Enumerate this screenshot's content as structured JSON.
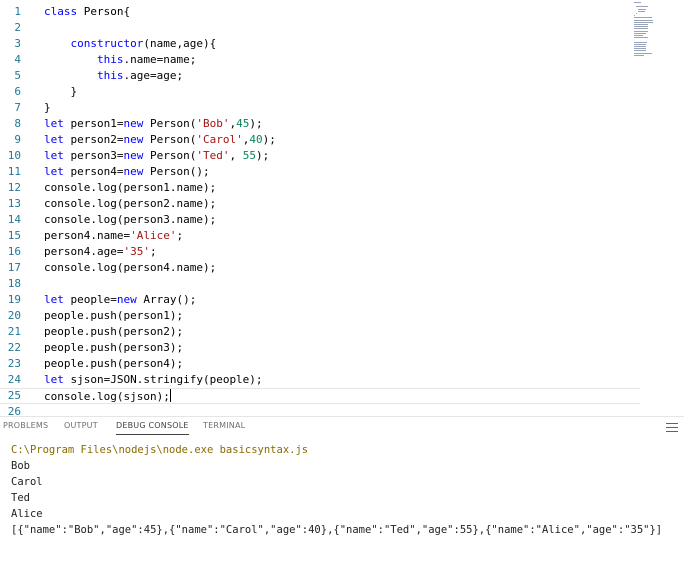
{
  "editor": {
    "lines": [
      {
        "n": "1",
        "tokens": [
          {
            "t": "class",
            "c": "kw"
          },
          {
            "t": " Person{",
            "c": ""
          }
        ]
      },
      {
        "n": "2",
        "tokens": []
      },
      {
        "n": "3",
        "tokens": [
          {
            "t": "    constructor",
            "c": "kw"
          },
          {
            "t": "(name,age){",
            "c": ""
          }
        ]
      },
      {
        "n": "4",
        "tokens": [
          {
            "t": "        this",
            "c": "kw"
          },
          {
            "t": ".name=name;",
            "c": ""
          }
        ]
      },
      {
        "n": "5",
        "tokens": [
          {
            "t": "        this",
            "c": "kw"
          },
          {
            "t": ".age=age;",
            "c": ""
          }
        ]
      },
      {
        "n": "6",
        "tokens": [
          {
            "t": "    }",
            "c": ""
          }
        ]
      },
      {
        "n": "7",
        "tokens": [
          {
            "t": "}",
            "c": ""
          }
        ]
      },
      {
        "n": "8",
        "tokens": [
          {
            "t": "let",
            "c": "kw"
          },
          {
            "t": " person1=",
            "c": ""
          },
          {
            "t": "new",
            "c": "kw"
          },
          {
            "t": " Person(",
            "c": ""
          },
          {
            "t": "'Bob'",
            "c": "str"
          },
          {
            "t": ",",
            "c": ""
          },
          {
            "t": "45",
            "c": "num"
          },
          {
            "t": ");",
            "c": ""
          }
        ]
      },
      {
        "n": "9",
        "tokens": [
          {
            "t": "let",
            "c": "kw"
          },
          {
            "t": " person2=",
            "c": ""
          },
          {
            "t": "new",
            "c": "kw"
          },
          {
            "t": " Person(",
            "c": ""
          },
          {
            "t": "'Carol'",
            "c": "str"
          },
          {
            "t": ",",
            "c": ""
          },
          {
            "t": "40",
            "c": "num"
          },
          {
            "t": ");",
            "c": ""
          }
        ]
      },
      {
        "n": "10",
        "tokens": [
          {
            "t": "let",
            "c": "kw"
          },
          {
            "t": " person3=",
            "c": ""
          },
          {
            "t": "new",
            "c": "kw"
          },
          {
            "t": " Person(",
            "c": ""
          },
          {
            "t": "'Ted'",
            "c": "str"
          },
          {
            "t": ", ",
            "c": ""
          },
          {
            "t": "55",
            "c": "num"
          },
          {
            "t": ");",
            "c": ""
          }
        ]
      },
      {
        "n": "11",
        "tokens": [
          {
            "t": "let",
            "c": "kw"
          },
          {
            "t": " person4=",
            "c": ""
          },
          {
            "t": "new",
            "c": "kw"
          },
          {
            "t": " Person();",
            "c": ""
          }
        ]
      },
      {
        "n": "12",
        "tokens": [
          {
            "t": "console.log(person1.name);",
            "c": ""
          }
        ]
      },
      {
        "n": "13",
        "tokens": [
          {
            "t": "console.log(person2.name);",
            "c": ""
          }
        ]
      },
      {
        "n": "14",
        "tokens": [
          {
            "t": "console.log(person3.name);",
            "c": ""
          }
        ]
      },
      {
        "n": "15",
        "tokens": [
          {
            "t": "person4.name=",
            "c": ""
          },
          {
            "t": "'Alice'",
            "c": "str"
          },
          {
            "t": ";",
            "c": ""
          }
        ]
      },
      {
        "n": "16",
        "tokens": [
          {
            "t": "person4.age=",
            "c": ""
          },
          {
            "t": "'35'",
            "c": "str"
          },
          {
            "t": ";",
            "c": ""
          }
        ]
      },
      {
        "n": "17",
        "tokens": [
          {
            "t": "console.log(person4.name);",
            "c": ""
          }
        ]
      },
      {
        "n": "18",
        "tokens": []
      },
      {
        "n": "19",
        "tokens": [
          {
            "t": "let",
            "c": "kw"
          },
          {
            "t": " people=",
            "c": ""
          },
          {
            "t": "new",
            "c": "kw"
          },
          {
            "t": " Array();",
            "c": ""
          }
        ]
      },
      {
        "n": "20",
        "tokens": [
          {
            "t": "people.push(person1);",
            "c": ""
          }
        ]
      },
      {
        "n": "21",
        "tokens": [
          {
            "t": "people.push(person2);",
            "c": ""
          }
        ]
      },
      {
        "n": "22",
        "tokens": [
          {
            "t": "people.push(person3);",
            "c": ""
          }
        ]
      },
      {
        "n": "23",
        "tokens": [
          {
            "t": "people.push(person4);",
            "c": ""
          }
        ]
      },
      {
        "n": "24",
        "tokens": [
          {
            "t": "let",
            "c": "kw"
          },
          {
            "t": " sjson=JSON.stringify(people);",
            "c": ""
          }
        ]
      },
      {
        "n": "25",
        "tokens": [
          {
            "t": "console.log(sjson);",
            "c": ""
          }
        ],
        "current": true
      },
      {
        "n": "26",
        "tokens": []
      }
    ]
  },
  "panel": {
    "tabs": [
      {
        "label": "PROBLEMS",
        "active": false
      },
      {
        "label": "OUTPUT",
        "active": false
      },
      {
        "label": "DEBUG CONSOLE",
        "active": true
      },
      {
        "label": "TERMINAL",
        "active": false
      }
    ],
    "menu_icon": "hamburger-icon",
    "output": [
      {
        "text": "C:\\Program Files\\nodejs\\node.exe basicsyntax.js",
        "kind": "cmd"
      },
      {
        "text": "Bob",
        "kind": "log"
      },
      {
        "text": "Carol",
        "kind": "log"
      },
      {
        "text": "Ted",
        "kind": "log"
      },
      {
        "text": "Alice",
        "kind": "log"
      },
      {
        "text": "[{\"name\":\"Bob\",\"age\":45},{\"name\":\"Carol\",\"age\":40},{\"name\":\"Ted\",\"age\":55},{\"name\":\"Alice\",\"age\":\"35\"}]",
        "kind": "log"
      }
    ]
  },
  "colors": {
    "keyword": "#0000ff",
    "string": "#a31515",
    "number": "#098658",
    "line_number": "#237893",
    "command_path": "#8a6a00"
  }
}
